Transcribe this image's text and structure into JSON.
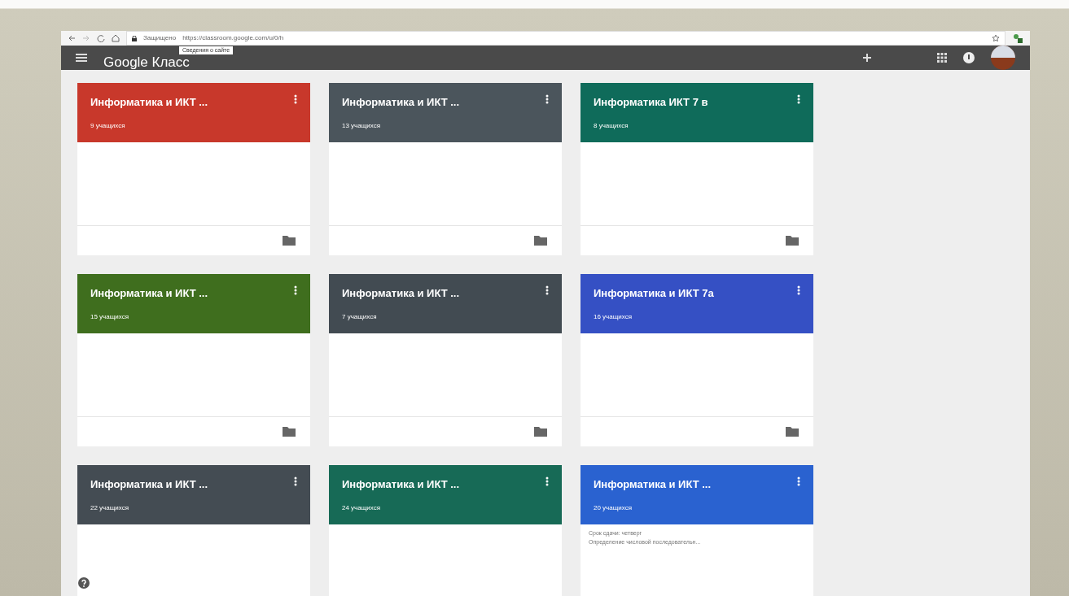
{
  "browser": {
    "security_label": "Защищено",
    "url": "https://classroom.google.com/u/0/h",
    "tooltip": "Сведения о сайте"
  },
  "app_bar": {
    "title": "Google Класс"
  },
  "classes": [
    {
      "title": "Информатика и ИКТ ...",
      "students": "9 учащихся",
      "color": "#c8382b"
    },
    {
      "title": "Информатика и ИКТ ...",
      "students": "13 учащихся",
      "color": "#4b555c"
    },
    {
      "title": "Информатика ИКТ 7 в",
      "students": "8 учащихся",
      "color": "#0f6b5a"
    },
    {
      "title": "Информатика и ИКТ ...",
      "students": "15 учащихся",
      "color": "#3f6e1e"
    },
    {
      "title": "Информатика и ИКТ ...",
      "students": "7 учащихся",
      "color": "#424b52"
    },
    {
      "title": "Информатика и ИКТ 7а",
      "students": "16 учащихся",
      "color": "#3550c4"
    },
    {
      "title": "Информатика и ИКТ ...",
      "students": "22 учащихся",
      "color": "#444c53"
    },
    {
      "title": "Информатика и ИКТ ...",
      "students": "24 учащихся",
      "color": "#176a56"
    },
    {
      "title": "Информатика и ИКТ ...",
      "students": "20 учащихся",
      "color": "#2a62d0",
      "due": "Срок сдачи: четверг",
      "assignment": "Определение числовой последовательн..."
    }
  ]
}
